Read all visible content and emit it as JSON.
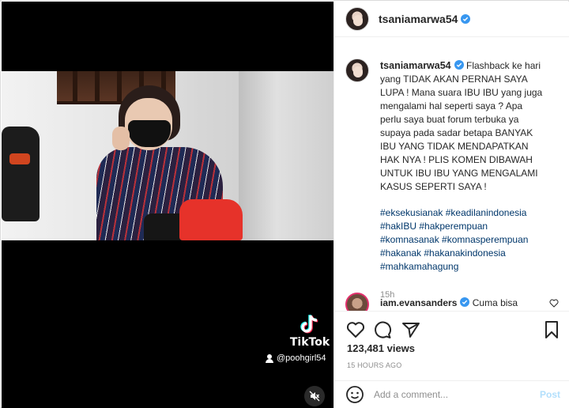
{
  "post": {
    "username": "tsaniamarwa54",
    "verified": true,
    "caption_lines": [
      "Flashback ke hari",
      "yang TIDAK AKAN PERNAH SAYA",
      "LUPA ! Mana suara IBU IBU yang juga",
      "mengalami hal seperti saya ? Apa",
      "perlu saya buat forum terbuka ya",
      "supaya pada sadar betapa BANYAK",
      "IBU YANG TIDAK MENDAPATKAN",
      "HAK NYA ! PLIS KOMEN DIBAWAH",
      "UNTUK IBU IBU YANG MENGALAMI",
      "KASUS SEPERTI SAYA !"
    ],
    "hashtag_lines": [
      "#eksekusianak #keadilanindonesia",
      "#hakIBU #hakperempuan",
      "#komnasanak #komnasperempuan",
      "#hakanak #hakanakindonesia",
      "#mahkamahagung"
    ],
    "caption_age": "15h",
    "views": "123,481 views",
    "timestamp": "15 HOURS AGO"
  },
  "comment": {
    "username": "iam.evansanders",
    "verified": true,
    "text": "Cuma bisa"
  },
  "video": {
    "watermark": "TikTok",
    "tiktok_user": "@poohgirl54"
  },
  "comment_box": {
    "placeholder": "Add a comment...",
    "post_label": "Post"
  },
  "icons": {
    "like": "heart-icon",
    "comment": "speech-bubble-icon",
    "share": "paper-plane-icon",
    "save": "bookmark-icon",
    "emoji": "smiley-icon",
    "mute": "muted-speaker-icon"
  },
  "colors": {
    "verified": "#3897f0",
    "hashtag": "#00376b",
    "muted_text": "#8e8e8e",
    "post_button": "#b2dffc"
  }
}
